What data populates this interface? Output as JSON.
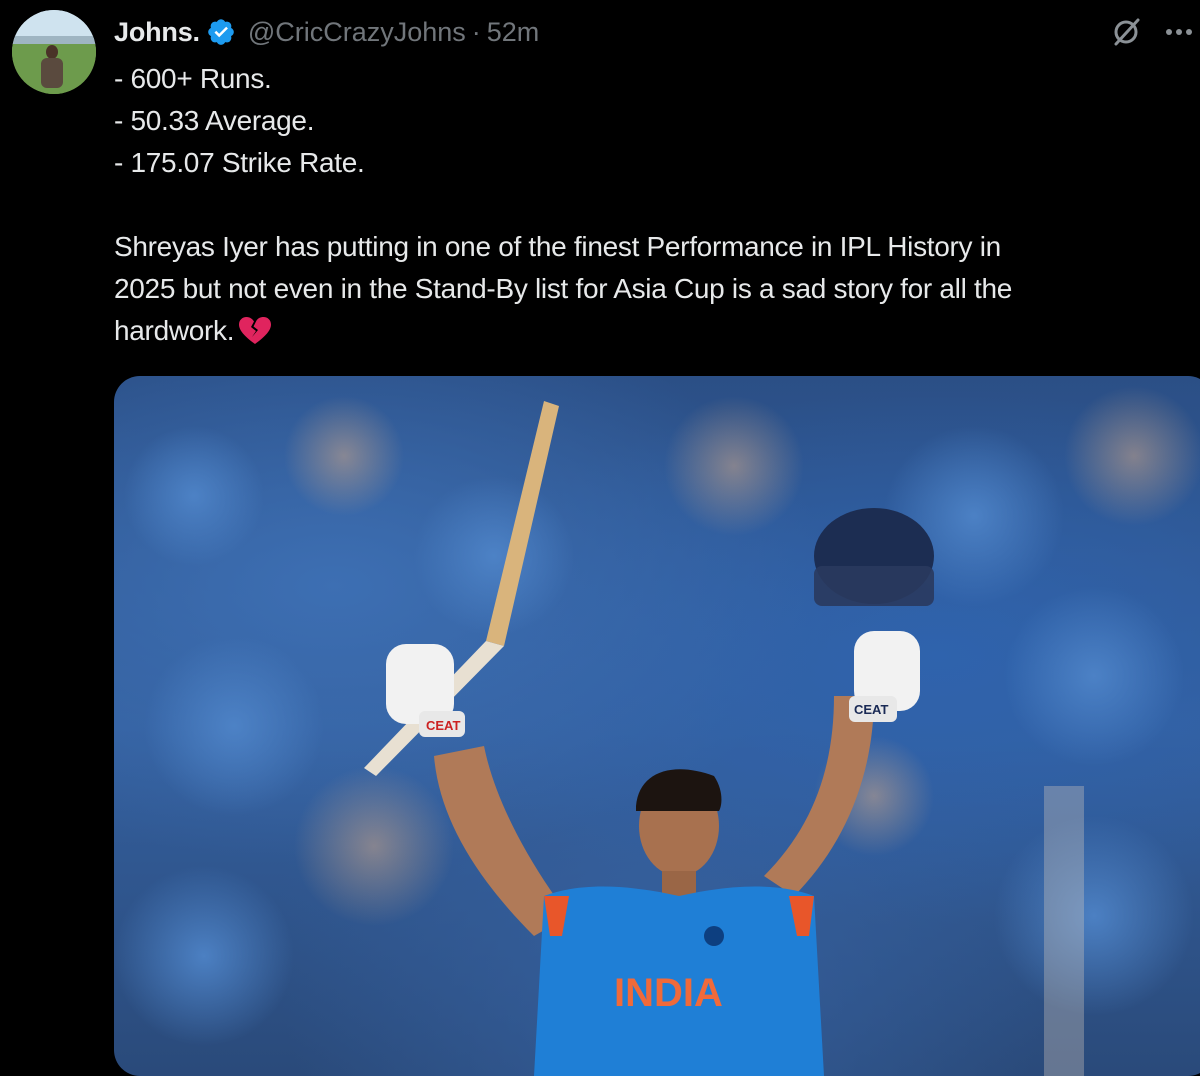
{
  "tweet": {
    "author": {
      "display_name": "Johns.",
      "handle": "@CricCrazyJohns",
      "verified": true
    },
    "separator": "·",
    "time": "52m",
    "text_lines": [
      "- 600+ Runs.",
      "- 50.33 Average.",
      "- 175.07 Strike Rate."
    ],
    "body_lines": [
      "Shreyas Iyer has putting in one of the finest Performance in IPL History in",
      "2025 but not even in the Stand-By list for Asia Cup is a sad story for all the",
      "hardwork."
    ],
    "emoji": "broken-heart",
    "media": {
      "jersey_text": "INDIA",
      "glove_brand": "CEAT"
    }
  },
  "colors": {
    "background": "#000000",
    "text": "#e7e9ea",
    "muted": "#71767b",
    "verified": "#1d9bf0",
    "jersey": "#1f7fd6"
  },
  "icons": {
    "verified": "verified-badge-icon",
    "grok": "grok-icon",
    "more": "more-options-icon",
    "emoji": "broken-heart-icon"
  }
}
